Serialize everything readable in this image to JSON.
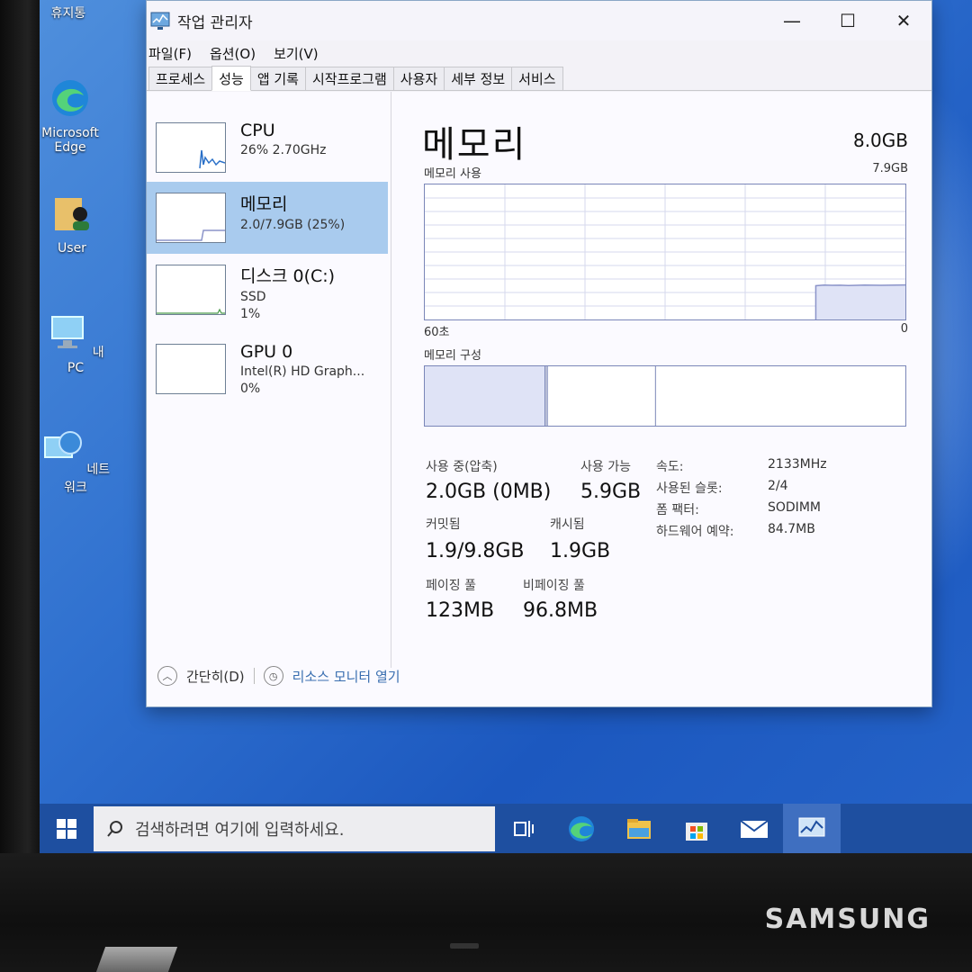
{
  "desktop": {
    "icons": [
      {
        "label": "휴지통",
        "icon": "recycle-bin-icon"
      },
      {
        "label": "Microsoft Edge",
        "icon": "edge-icon"
      },
      {
        "label": "User",
        "icon": "user-folder-icon"
      },
      {
        "label": "내 PC",
        "icon": "this-pc-icon"
      },
      {
        "label": "네트워크",
        "icon": "network-icon"
      }
    ]
  },
  "window": {
    "title": "작업 관리자",
    "controls": {
      "minimize": "—",
      "maximize": "☐",
      "close": "✕"
    },
    "menu": [
      "파일(F)",
      "옵션(O)",
      "보기(V)"
    ],
    "tabs": [
      "프로세스",
      "성능",
      "앱 기록",
      "시작프로그램",
      "사용자",
      "세부 정보",
      "서비스"
    ],
    "active_tab": "성능"
  },
  "sidebar": {
    "items": [
      {
        "name": "CPU",
        "sub1": "26% 2.70GHz",
        "sub2": ""
      },
      {
        "name": "메모리",
        "sub1": "2.0/7.9GB (25%)",
        "sub2": ""
      },
      {
        "name": "디스크 0(C:)",
        "sub1": "SSD",
        "sub2": "1%"
      },
      {
        "name": "GPU 0",
        "sub1": "Intel(R) HD Graph...",
        "sub2": "0%"
      }
    ],
    "selected": "메모리"
  },
  "memory": {
    "title": "메모리",
    "total": "8.0GB",
    "usage_label": "메모리 사용",
    "usage_max": "7.9GB",
    "axis_left": "60초",
    "axis_right": "0",
    "composition_label": "메모리 구성",
    "composition": [
      {
        "part": "in-use",
        "fraction": 0.25
      },
      {
        "part": "modified",
        "fraction": 0.005
      },
      {
        "part": "standby",
        "fraction": 0.225
      },
      {
        "part": "free",
        "fraction": 0.52
      }
    ],
    "usage_history": [
      0,
      0,
      0,
      0,
      0,
      0,
      0,
      0,
      0,
      0,
      0,
      0,
      0,
      0,
      0,
      0,
      0,
      0,
      0,
      0,
      0,
      0,
      0,
      0,
      0,
      0,
      0,
      0,
      0,
      0,
      0,
      0,
      0,
      0,
      0,
      0,
      0,
      0,
      0,
      0,
      0,
      0,
      0,
      0,
      0,
      0,
      0,
      0,
      0.25,
      0.255,
      0.253,
      0.254,
      0.252,
      0.253,
      0.255,
      0.254,
      0.253,
      0.254,
      0.255,
      0.256
    ],
    "stats": {
      "in_use_label": "사용 중(압축)",
      "in_use_value": "2.0GB (0MB)",
      "available_label": "사용 가능",
      "available_value": "5.9GB",
      "committed_label": "커밋됨",
      "committed_value": "1.9/9.8GB",
      "cached_label": "캐시됨",
      "cached_value": "1.9GB",
      "paged_label": "페이징 풀",
      "paged_value": "123MB",
      "nonpaged_label": "비페이징 풀",
      "nonpaged_value": "96.8MB"
    },
    "details": [
      {
        "label": "속도:",
        "value": "2133MHz"
      },
      {
        "label": "사용된 슬롯:",
        "value": "2/4"
      },
      {
        "label": "폼 팩터:",
        "value": "SODIMM"
      },
      {
        "label": "하드웨어 예약:",
        "value": "84.7MB"
      }
    ]
  },
  "footer": {
    "collapse": "간단히(D)",
    "resource_monitor": "리소스 모니터 열기"
  },
  "taskbar": {
    "search_placeholder": "검색하려면 여기에 입력하세요.",
    "apps": [
      "task-view-icon",
      "edge-icon",
      "file-explorer-icon",
      "store-icon",
      "mail-icon",
      "task-manager-icon"
    ]
  },
  "monitor": {
    "brand": "SAMSUNG"
  },
  "colors": {
    "selected": "#a9cbee",
    "graph_line": "#8b94c9",
    "graph_fill": "#dfe3f6",
    "taskbar": "#1e4fa0"
  }
}
